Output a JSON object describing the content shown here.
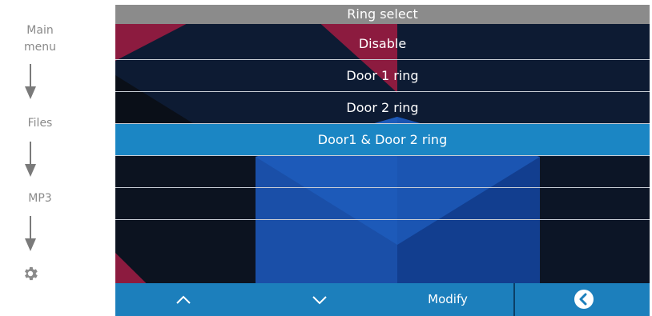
{
  "breadcrumb": {
    "items": [
      {
        "label": "Main\nmenu"
      },
      {
        "label": "Files"
      },
      {
        "label": "MP3"
      }
    ],
    "last_icon": "gear-icon"
  },
  "screen": {
    "title": "Ring select",
    "options": [
      {
        "label": "Disable",
        "selected": false
      },
      {
        "label": "Door 1 ring",
        "selected": false
      },
      {
        "label": "Door 2 ring",
        "selected": false
      },
      {
        "label": "Door1 & Door 2 ring",
        "selected": true
      },
      {
        "label": "",
        "selected": false
      },
      {
        "label": "",
        "selected": false
      },
      {
        "label": "",
        "selected": false
      }
    ],
    "toolbar": {
      "up_icon": "chevron-up-icon",
      "down_icon": "chevron-down-icon",
      "modify_label": "Modify",
      "back_icon": "back-circle-icon"
    }
  },
  "colors": {
    "title_bar": "#8b8b8b",
    "selected_row": "#1b86c4",
    "toolbar": "#1c7fbc",
    "background": "#0d1c35"
  }
}
